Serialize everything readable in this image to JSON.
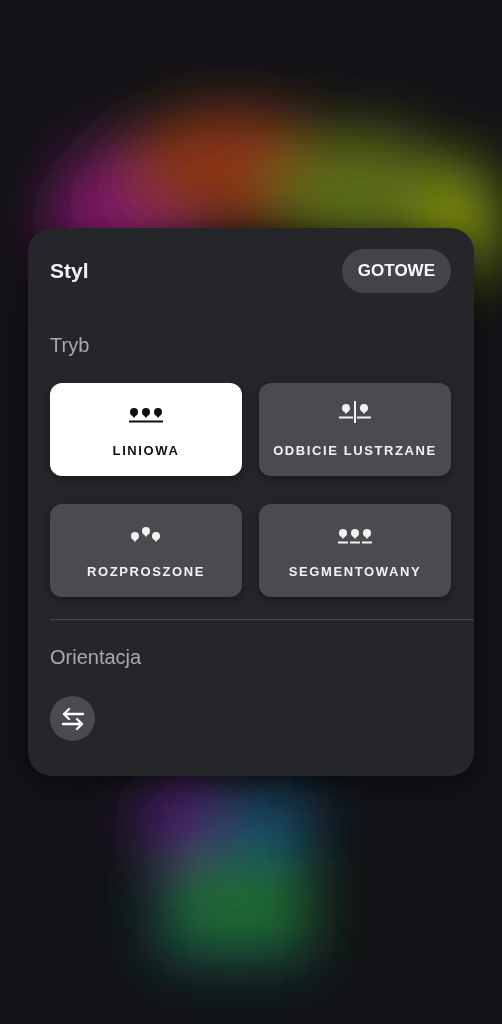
{
  "panel": {
    "title": "Styl",
    "done_button": "GOTOWE"
  },
  "mode_section": {
    "label": "Tryb",
    "modes": [
      {
        "kind": "linear",
        "label": "LINIOWA",
        "selected": true
      },
      {
        "kind": "mirror",
        "label": "ODBICIE LUSTRZANE",
        "selected": false
      },
      {
        "kind": "scattered",
        "label": "ROZPROSZONE",
        "selected": false
      },
      {
        "kind": "segmented",
        "label": "SEGMENTOWANY",
        "selected": false
      }
    ]
  },
  "orientation_section": {
    "label": "Orientacja"
  }
}
